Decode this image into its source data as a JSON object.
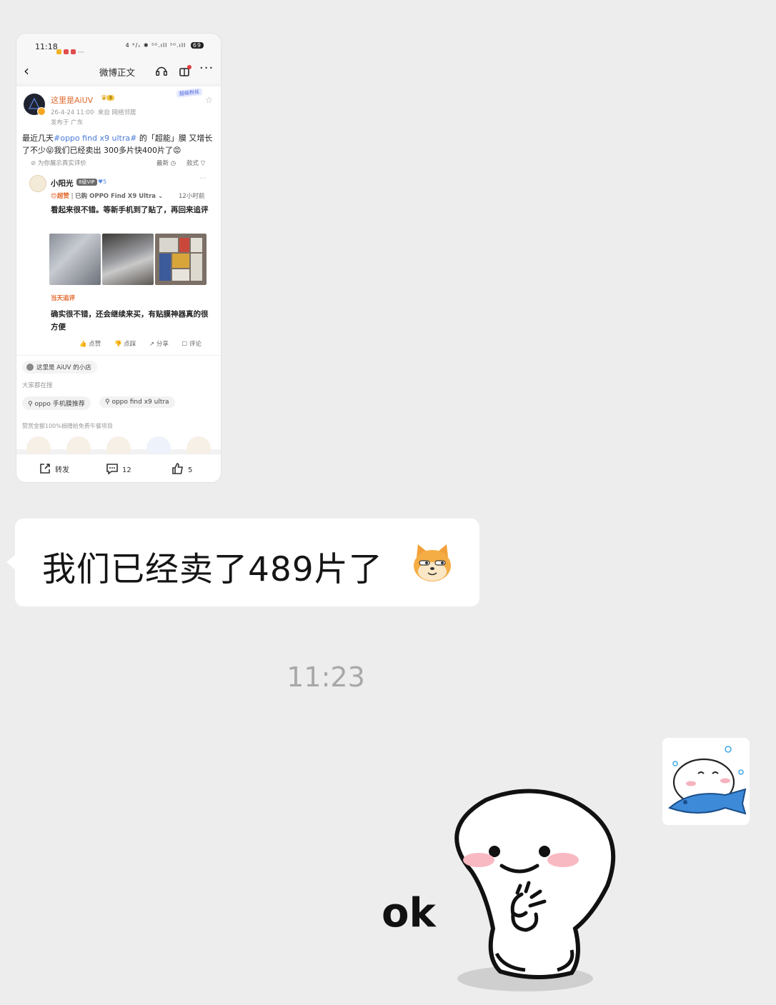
{
  "screenshot": {
    "status_time": "11:18",
    "status_right": "4 ᴷ/ₛ ✱ ⁵ᴳ.ıll ⁵ᴳ.ıll",
    "battery": "69",
    "nav_title": "微博正文",
    "post": {
      "username": "这里是AiUV",
      "level_badge": "Ⅱ",
      "top_tag": "超级粉丝",
      "meta_time": "26-4-24 11:00",
      "meta_source": "来自 网络邻居",
      "meta_location": "发布于 广东",
      "text_before": "最近几天",
      "hashtag": "#oppo find x9 ultra#",
      "text_after": " 的「超能」膜 又增长了不少😝我们已经卖出 300多片快400片了😡",
      "helper_text": "⊘ 为你展示真实评价",
      "sort_latest": "最新 ◷",
      "sort_style": "款式 ▽"
    },
    "comment": {
      "name": "小阳光",
      "vip": "8级VIP",
      "dot": "♥5",
      "badge": "😍超赞",
      "purchase": "已购 OPPO Find X9 Ultra ⌄",
      "time": "12小时前",
      "text": "看起来很不错。等新手机到了贴了，再回来追评",
      "follow_label": "当天追评",
      "follow_text": "确实很不错，还会继续来买，有贴膜神器真的很方便",
      "actions": [
        "👍 点赞",
        "👎 点踩",
        "↗ 分享",
        "☐ 评论"
      ]
    },
    "shop": "这里是 AiUV 的小店",
    "search_label": "大家都在搜",
    "search_chips": [
      "⚲ oppo 手机膜推荐",
      "⚲ oppo find x9 ultra"
    ],
    "reward_text": "赞赏金额100%捐赠给免费午餐项目",
    "bottom_bar": {
      "repost": "转发",
      "comments": "12",
      "likes": "5"
    }
  },
  "message": {
    "text": "我们已经卖了489片了",
    "emoji": "doge-cat-emoji"
  },
  "timestamp": "11:23",
  "sticker": {
    "text": "ok",
    "name": "ok-hand-sticker"
  },
  "colors": {
    "background": "#ededed",
    "bubble": "#ffffff",
    "accent_orange": "#e0672b",
    "hashtag_blue": "#4a7bd6"
  }
}
